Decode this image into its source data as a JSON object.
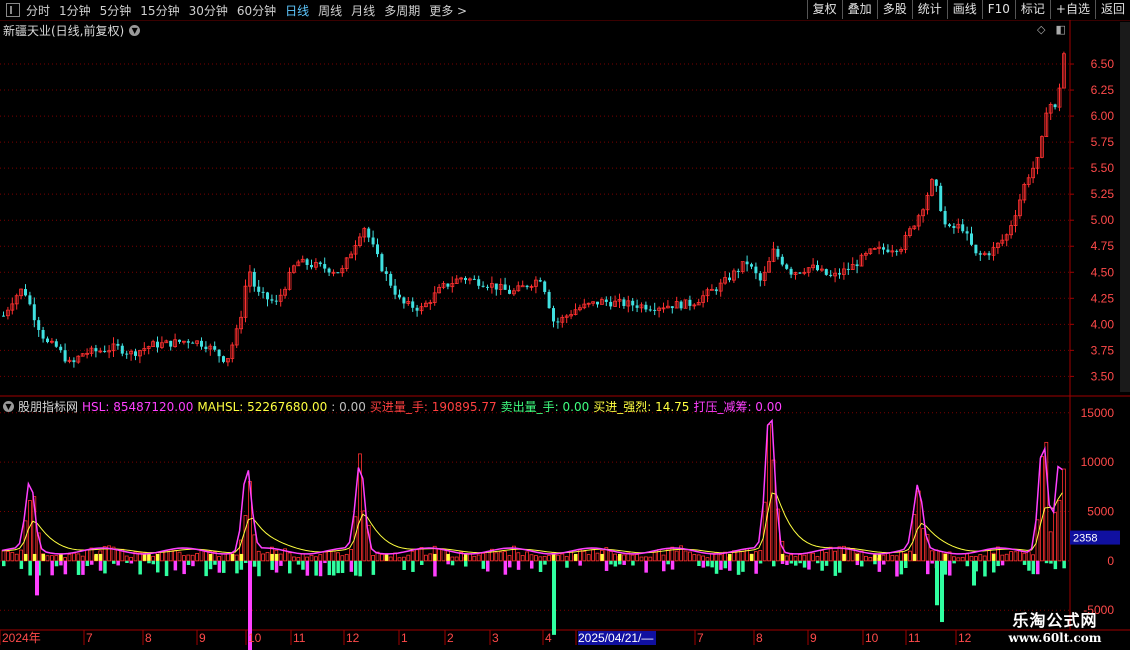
{
  "toolbar": {
    "periods": [
      {
        "label": "分时",
        "active": false
      },
      {
        "label": "1分钟",
        "active": false
      },
      {
        "label": "5分钟",
        "active": false
      },
      {
        "label": "15分钟",
        "active": false
      },
      {
        "label": "30分钟",
        "active": false
      },
      {
        "label": "60分钟",
        "active": false
      },
      {
        "label": "日线",
        "active": true
      },
      {
        "label": "周线",
        "active": false
      },
      {
        "label": "月线",
        "active": false
      },
      {
        "label": "多周期",
        "active": false
      },
      {
        "label": "更多 >",
        "active": false
      }
    ],
    "buttons": [
      "复权",
      "叠加",
      "多股",
      "统计",
      "画线",
      "F10",
      "标记",
      "+自选",
      "返回"
    ]
  },
  "main_chart": {
    "title": "新疆天业(日线,前复权)",
    "y_ticks": [
      "6.50",
      "6.25",
      "6.00",
      "5.75",
      "5.50",
      "5.25",
      "5.00",
      "4.75",
      "4.50",
      "4.25",
      "4.00",
      "3.75",
      "3.50"
    ],
    "y_min": 3.35,
    "y_max": 6.75
  },
  "indicator": {
    "name": "股朋指标网",
    "values": [
      {
        "label": "HSL: 85487120.00",
        "color": "#ff40ff"
      },
      {
        "label": "MAHSL: 52267680.00",
        "color": "#ffff40"
      },
      {
        "label": ": 0.00",
        "color": "#c0c0c0"
      },
      {
        "label": "买进量_手: 190895.77",
        "color": "#ff4040"
      },
      {
        "label": "卖出量_手: 0.00",
        "color": "#40ff80"
      },
      {
        "label": "买进_强烈: 14.75",
        "color": "#ffff40"
      },
      {
        "label": "打压_减筹: 0.00",
        "color": "#ff40ff"
      }
    ],
    "y_ticks": [
      "15000",
      "10000",
      "5000",
      "0",
      "-5000"
    ],
    "y_min": -6500,
    "y_max": 16500,
    "cursor_value": "2358"
  },
  "x_axis": {
    "labels": [
      "2024年",
      "7",
      "8",
      "9",
      "10",
      "11",
      "12",
      "1",
      "2",
      "3",
      "4",
      "2025/04/21/—",
      "7",
      "8",
      "9",
      "10",
      "11",
      "12"
    ]
  },
  "watermark": {
    "line1": "乐淘公式网",
    "line2": "www.60lt.com"
  },
  "colors": {
    "up": "#ff3030",
    "down": "#40e0e0",
    "grid": "#7a0000",
    "axis": "#a00000",
    "buy": "#ff3030",
    "sell": "#30ffa0",
    "hsl": "#ff40ff",
    "mahsl": "#ffff40"
  }
}
